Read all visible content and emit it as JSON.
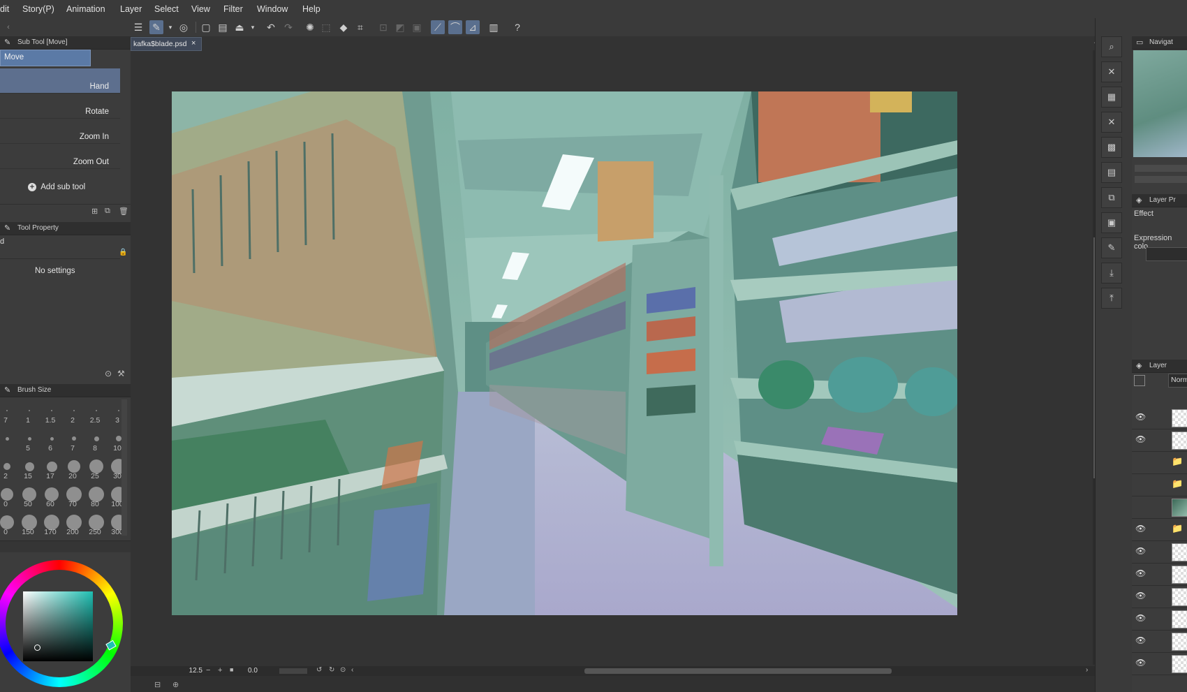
{
  "menu": [
    "dit",
    "Story(P)",
    "Animation",
    "Layer",
    "Select",
    "View",
    "Filter",
    "Window",
    "Help"
  ],
  "subtool_panel": {
    "header": "Sub Tool [Move]",
    "group_tab": "Move",
    "items": [
      "Hand",
      "Rotate",
      "Zoom In",
      "Zoom Out"
    ],
    "add_label": "Add sub tool"
  },
  "tool_property": {
    "header": "Tool Property",
    "tool_name": "d",
    "empty_text": "No settings"
  },
  "brush_size": {
    "header": "Brush Size",
    "sizes": [
      "7",
      "1",
      "1.5",
      "2",
      "2.5",
      "3",
      "",
      "5",
      "6",
      "7",
      "8",
      "10",
      "2",
      "15",
      "17",
      "20",
      "25",
      "30",
      "0",
      "50",
      "60",
      "70",
      "80",
      "100",
      "0",
      "150",
      "170",
      "200",
      "250",
      "300"
    ]
  },
  "document": {
    "tab_name": "kafka$blade.psd",
    "zoom": "12.5",
    "rotation": "0.0"
  },
  "right": {
    "navigator_header": "Navigat",
    "layer_property_header": "Layer Pr",
    "effect_label": "Effect",
    "expression_label": "Expression colo",
    "layer_header": "Layer",
    "blend_mode": "Norm"
  },
  "colors": {
    "accent": "#5a6f8e",
    "color_square_main": "#1fbfb2"
  }
}
